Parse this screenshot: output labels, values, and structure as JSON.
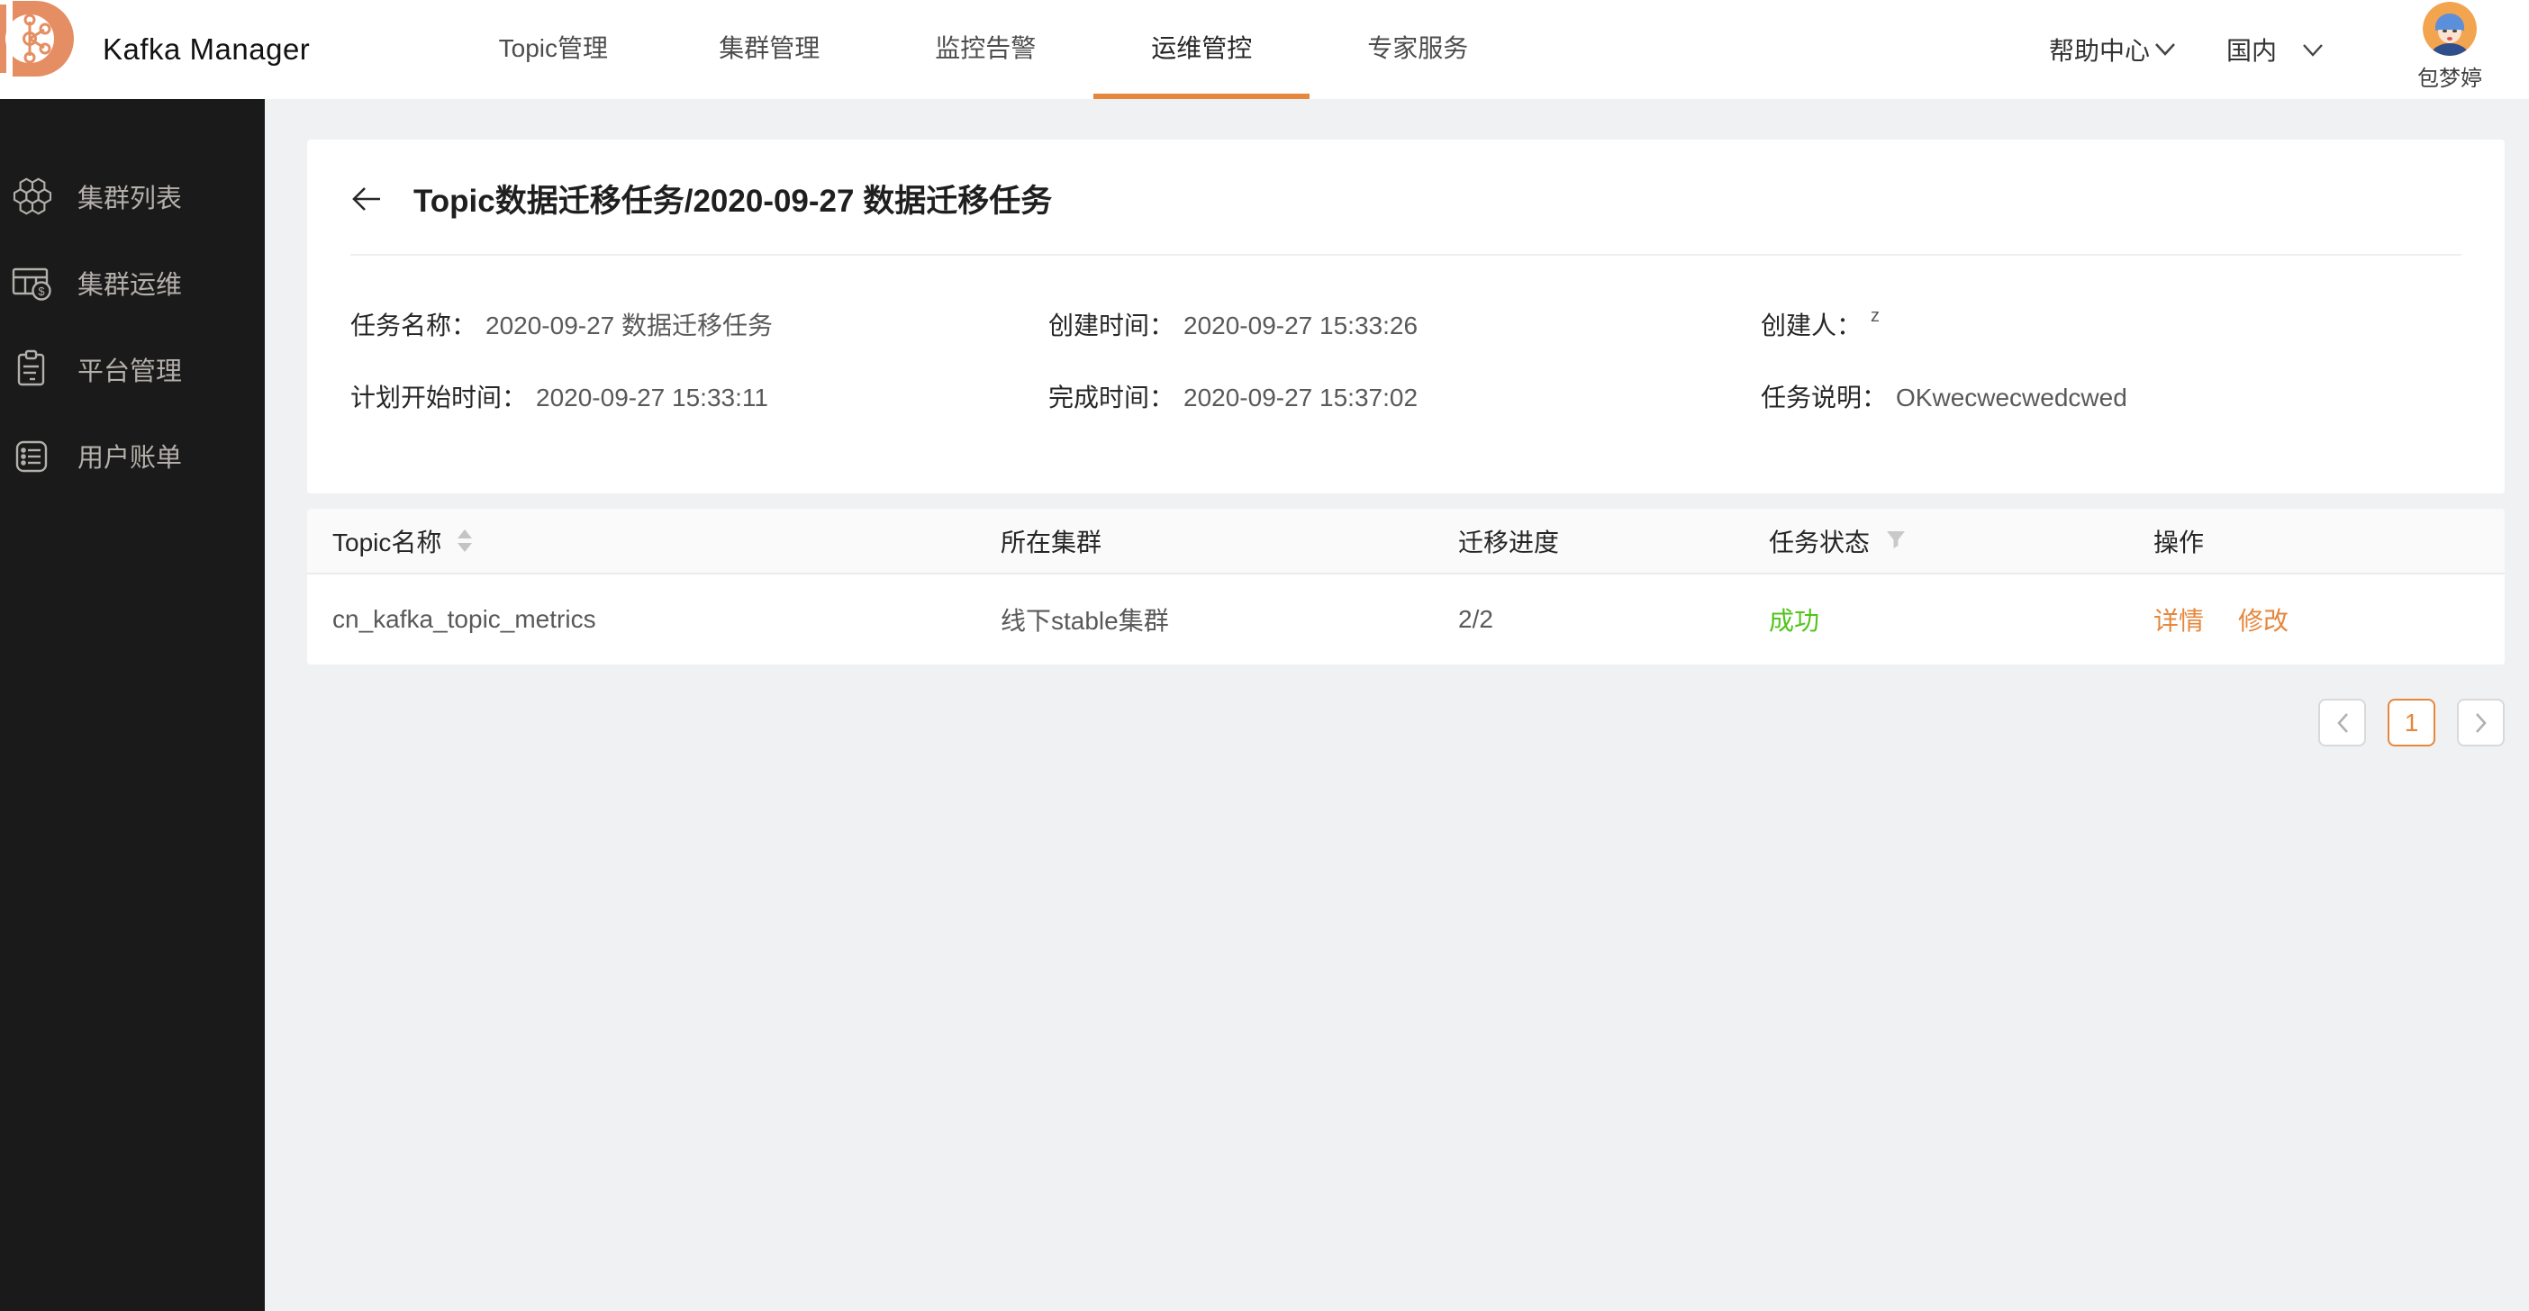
{
  "header": {
    "app_title": "Kafka Manager",
    "tabs": [
      {
        "label": "Topic管理",
        "active": false
      },
      {
        "label": "集群管理",
        "active": false
      },
      {
        "label": "监控告警",
        "active": false
      },
      {
        "label": "运维管控",
        "active": true
      },
      {
        "label": "专家服务",
        "active": false
      }
    ],
    "help_center": "帮助中心",
    "region": "国内",
    "user_name": "包梦婷"
  },
  "sidebar": {
    "items": [
      {
        "label": "集群列表",
        "icon": "cluster-list-icon"
      },
      {
        "label": "集群运维",
        "icon": "cluster-ops-icon"
      },
      {
        "label": "平台管理",
        "icon": "platform-manage-icon"
      },
      {
        "label": "用户账单",
        "icon": "user-billing-icon"
      }
    ]
  },
  "main": {
    "page_title": "Topic数据迁移任务/2020-09-27 数据迁移任务",
    "fields": [
      {
        "label": "任务名称：",
        "value": "2020-09-27 数据迁移任务"
      },
      {
        "label": "创建时间：",
        "value": "2020-09-27 15:33:26"
      },
      {
        "label": "创建人：",
        "value": "z"
      },
      {
        "label": "计划开始时间：",
        "value": "2020-09-27 15:33:11"
      },
      {
        "label": "完成时间：",
        "value": "2020-09-27 15:37:02"
      },
      {
        "label": "任务说明：",
        "value": "OKwecwecwedcwed"
      }
    ],
    "table": {
      "columns": [
        "Topic名称",
        "所在集群",
        "迁移进度",
        "任务状态",
        "操作"
      ],
      "rows": [
        {
          "topic": "cn_kafka_topic_metrics",
          "cluster": "线下stable集群",
          "progress": "2/2",
          "status": "成功",
          "actions": [
            "详情",
            "修改"
          ]
        }
      ]
    },
    "pagination": {
      "current_page": "1"
    }
  },
  "colors": {
    "accent": "#e5873c",
    "success": "#52c41a",
    "sidebar_bg": "#1a1a1a",
    "logo_orange": "#e58e63",
    "avatar_bg": "#f2a44f"
  }
}
